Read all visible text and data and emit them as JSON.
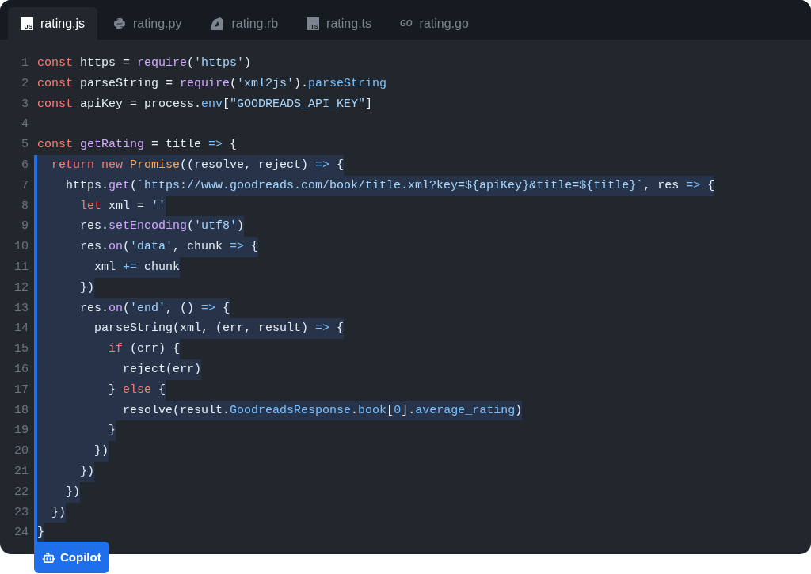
{
  "tabs": [
    {
      "label": "rating.js",
      "kind": "javascript",
      "icon_text": "JS",
      "selected": true
    },
    {
      "label": "rating.py",
      "kind": "python",
      "selected": false
    },
    {
      "label": "rating.rb",
      "kind": "ruby",
      "selected": false
    },
    {
      "label": "rating.ts",
      "kind": "typescript",
      "icon_text": "TS",
      "selected": false
    },
    {
      "label": "rating.go",
      "kind": "go",
      "icon_text": "GO",
      "selected": false
    }
  ],
  "code": {
    "lines": [
      {
        "number": "1",
        "suggested": false,
        "tokens": [
          {
            "text": "const",
            "kind": "keyword"
          },
          {
            "text": " https = ",
            "kind": "plain"
          },
          {
            "text": "require",
            "kind": "function"
          },
          {
            "text": "(",
            "kind": "plain"
          },
          {
            "text": "'https'",
            "kind": "string"
          },
          {
            "text": ")",
            "kind": "plain"
          }
        ]
      },
      {
        "number": "2",
        "suggested": false,
        "tokens": [
          {
            "text": "const",
            "kind": "keyword"
          },
          {
            "text": " parseString = ",
            "kind": "plain"
          },
          {
            "text": "require",
            "kind": "function"
          },
          {
            "text": "(",
            "kind": "plain"
          },
          {
            "text": "'xml2js'",
            "kind": "string"
          },
          {
            "text": ").",
            "kind": "plain"
          },
          {
            "text": "parseString",
            "kind": "member"
          }
        ]
      },
      {
        "number": "3",
        "suggested": false,
        "tokens": [
          {
            "text": "const",
            "kind": "keyword"
          },
          {
            "text": " apiKey = process.",
            "kind": "plain"
          },
          {
            "text": "env",
            "kind": "member"
          },
          {
            "text": "[",
            "kind": "plain"
          },
          {
            "text": "\"GOODREADS_API_KEY\"",
            "kind": "string"
          },
          {
            "text": "]",
            "kind": "plain"
          }
        ]
      },
      {
        "number": "4",
        "suggested": false
      },
      {
        "number": "5",
        "suggested": false,
        "tokens": [
          {
            "text": "const",
            "kind": "keyword"
          },
          {
            "text": " getRating",
            "kind": "function"
          },
          {
            "text": " = title ",
            "kind": "plain"
          },
          {
            "text": "=>",
            "kind": "operator"
          },
          {
            "text": " {",
            "kind": "plain"
          }
        ]
      },
      {
        "number": "6",
        "suggested": true,
        "tokens": [
          {
            "text": "  return",
            "kind": "keyword"
          },
          {
            "text": " new",
            "kind": "keyword"
          },
          {
            "text": " Promise",
            "kind": "class"
          },
          {
            "text": "((resolve, reject) ",
            "kind": "plain"
          },
          {
            "text": "=>",
            "kind": "operator"
          },
          {
            "text": " {",
            "kind": "plain"
          }
        ]
      },
      {
        "number": "7",
        "suggested": true,
        "tokens": [
          {
            "text": "    https.",
            "kind": "plain"
          },
          {
            "text": "get",
            "kind": "function"
          },
          {
            "text": "(",
            "kind": "plain"
          },
          {
            "text": "`https://www.goodreads.com/book/title.xml?key=${apiKey}&title=${title}`",
            "kind": "string"
          },
          {
            "text": ", res ",
            "kind": "plain"
          },
          {
            "text": "=>",
            "kind": "operator"
          },
          {
            "text": " {",
            "kind": "plain"
          }
        ]
      },
      {
        "number": "8",
        "suggested": true,
        "tokens": [
          {
            "text": "      let",
            "kind": "keyword"
          },
          {
            "text": " xml = ",
            "kind": "plain"
          },
          {
            "text": "''",
            "kind": "string"
          }
        ]
      },
      {
        "number": "9",
        "suggested": true,
        "tokens": [
          {
            "text": "      res.",
            "kind": "plain"
          },
          {
            "text": "setEncoding",
            "kind": "function"
          },
          {
            "text": "(",
            "kind": "plain"
          },
          {
            "text": "'utf8'",
            "kind": "string"
          },
          {
            "text": ")",
            "kind": "plain"
          }
        ]
      },
      {
        "number": "10",
        "suggested": true,
        "tokens": [
          {
            "text": "      res.",
            "kind": "plain"
          },
          {
            "text": "on",
            "kind": "function"
          },
          {
            "text": "(",
            "kind": "plain"
          },
          {
            "text": "'data'",
            "kind": "string"
          },
          {
            "text": ", chunk ",
            "kind": "plain"
          },
          {
            "text": "=>",
            "kind": "operator"
          },
          {
            "text": " {",
            "kind": "plain"
          }
        ]
      },
      {
        "number": "11",
        "suggested": true,
        "tokens": [
          {
            "text": "        xml ",
            "kind": "plain"
          },
          {
            "text": "+=",
            "kind": "operator"
          },
          {
            "text": " chunk",
            "kind": "plain"
          }
        ]
      },
      {
        "number": "12",
        "suggested": true,
        "tokens": [
          {
            "text": "      })",
            "kind": "plain"
          }
        ]
      },
      {
        "number": "13",
        "suggested": true,
        "tokens": [
          {
            "text": "      res.",
            "kind": "plain"
          },
          {
            "text": "on",
            "kind": "function"
          },
          {
            "text": "(",
            "kind": "plain"
          },
          {
            "text": "'end'",
            "kind": "string"
          },
          {
            "text": ", () ",
            "kind": "plain"
          },
          {
            "text": "=>",
            "kind": "operator"
          },
          {
            "text": " {",
            "kind": "plain"
          }
        ]
      },
      {
        "number": "14",
        "suggested": true,
        "tokens": [
          {
            "text": "        parseString(xml, (err, result) ",
            "kind": "plain"
          },
          {
            "text": "=>",
            "kind": "operator"
          },
          {
            "text": " {",
            "kind": "plain"
          }
        ]
      },
      {
        "number": "15",
        "suggested": true,
        "tokens": [
          {
            "text": "          if",
            "kind": "keyword"
          },
          {
            "text": " (err) {",
            "kind": "plain"
          }
        ]
      },
      {
        "number": "16",
        "suggested": true,
        "tokens": [
          {
            "text": "            reject(err)",
            "kind": "plain"
          }
        ]
      },
      {
        "number": "17",
        "suggested": true,
        "tokens": [
          {
            "text": "          } ",
            "kind": "plain"
          },
          {
            "text": "else",
            "kind": "keyword"
          },
          {
            "text": " {",
            "kind": "plain"
          }
        ]
      },
      {
        "number": "18",
        "suggested": true,
        "tokens": [
          {
            "text": "            resolve(result.",
            "kind": "plain"
          },
          {
            "text": "GoodreadsResponse",
            "kind": "member"
          },
          {
            "text": ".",
            "kind": "plain"
          },
          {
            "text": "book",
            "kind": "member"
          },
          {
            "text": "[",
            "kind": "plain"
          },
          {
            "text": "0",
            "kind": "member"
          },
          {
            "text": "].",
            "kind": "plain"
          },
          {
            "text": "average_rating",
            "kind": "member"
          },
          {
            "text": ")",
            "kind": "plain"
          }
        ]
      },
      {
        "number": "19",
        "suggested": true,
        "tokens": [
          {
            "text": "          }",
            "kind": "plain"
          }
        ]
      },
      {
        "number": "20",
        "suggested": true,
        "tokens": [
          {
            "text": "        })",
            "kind": "plain"
          }
        ]
      },
      {
        "number": "21",
        "suggested": true,
        "tokens": [
          {
            "text": "      })",
            "kind": "plain"
          }
        ]
      },
      {
        "number": "22",
        "suggested": true,
        "tokens": [
          {
            "text": "    })",
            "kind": "plain"
          }
        ]
      },
      {
        "number": "23",
        "suggested": true,
        "tokens": [
          {
            "text": "  })",
            "kind": "plain"
          }
        ]
      },
      {
        "number": "24",
        "suggested": true,
        "tokens": [
          {
            "text": "}",
            "kind": "plain"
          }
        ]
      }
    ]
  },
  "copilot_button": {
    "label": "Copilot"
  }
}
